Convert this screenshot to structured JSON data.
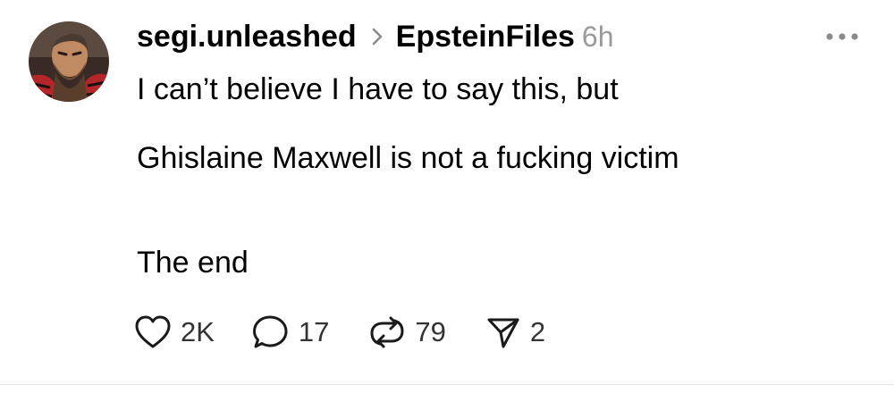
{
  "post": {
    "username": "segi.unleashed",
    "community": "EpsteinFiles",
    "time": "6h",
    "lines": [
      "I can’t believe I have to say this, but",
      "Ghislaine Maxwell is not a fucking victim",
      "The end"
    ],
    "counts": {
      "likes": "2K",
      "replies": "17",
      "reposts": "79",
      "shares": "2"
    }
  },
  "icons": {
    "more": "more-horizontal-icon",
    "chevron": "chevron-right-icon",
    "like": "heart-icon",
    "reply": "speech-bubble-icon",
    "repost": "repost-arrows-icon",
    "share": "send-icon"
  },
  "colors": {
    "text": "#000000",
    "muted": "#9a9a9a",
    "icon": "#1a1a1a",
    "divider": "#e3e3e3"
  }
}
